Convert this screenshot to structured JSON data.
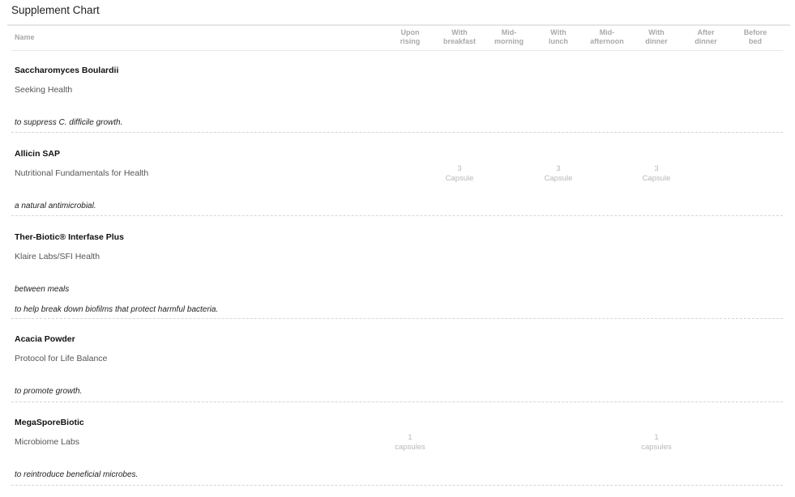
{
  "page": {
    "title": "Supplement Chart"
  },
  "table": {
    "name_header": "Name",
    "columns": [
      {
        "line1": "Upon",
        "line2": "rising"
      },
      {
        "line1": "With",
        "line2": "breakfast"
      },
      {
        "line1": "Mid-",
        "line2": "morning"
      },
      {
        "line1": "With",
        "line2": "lunch"
      },
      {
        "line1": "Mid-",
        "line2": "afternoon"
      },
      {
        "line1": "With",
        "line2": "dinner"
      },
      {
        "line1": "After",
        "line2": "dinner"
      },
      {
        "line1": "Before",
        "line2": "bed"
      }
    ],
    "rows": [
      {
        "name": "Saccharomyces Boulardii",
        "brand": "Seeking Health",
        "notes": [
          "to suppress C. difficile growth."
        ],
        "doses": [
          "",
          "",
          "",
          "",
          "",
          "",
          "",
          ""
        ]
      },
      {
        "name": "Allicin SAP",
        "brand": "Nutritional Fundamentals for Health",
        "notes": [
          "a natural antimicrobial."
        ],
        "doses": [
          "",
          "3|Capsule",
          "",
          "3|Capsule",
          "",
          "3|Capsule",
          "",
          ""
        ]
      },
      {
        "name": "Ther-Biotic® Interfase Plus",
        "brand": "Klaire Labs/SFI Health",
        "notes": [
          "between meals",
          "to help break down biofilms that protect harmful bacteria."
        ],
        "doses": [
          "",
          "",
          "",
          "",
          "",
          "",
          "",
          ""
        ]
      },
      {
        "name": "Acacia Powder",
        "brand": "Protocol for Life Balance",
        "notes": [
          "to promote growth."
        ],
        "doses": [
          "",
          "",
          "",
          "",
          "",
          "",
          "",
          ""
        ]
      },
      {
        "name": "MegaSporeBiotic",
        "brand": "Microbiome Labs",
        "notes": [
          "to reintroduce beneficial microbes."
        ],
        "doses": [
          "1|capsules",
          "",
          "",
          "",
          "",
          "1|capsules",
          "",
          ""
        ]
      }
    ]
  }
}
